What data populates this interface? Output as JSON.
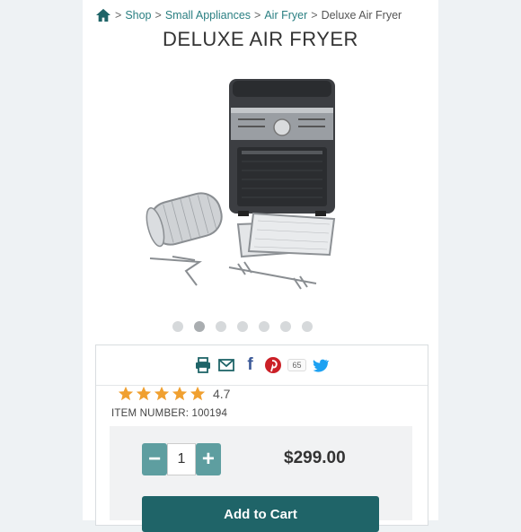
{
  "breadcrumb": {
    "home_icon": "home-icon",
    "items": [
      "Shop",
      "Small Appliances",
      "Air Fryer"
    ],
    "separator": ">",
    "current": "Deluxe Air Fryer"
  },
  "product": {
    "title": "DELUXE AIR FRYER",
    "image_alt": "Deluxe Air Fryer with rotisserie basket, cooking trays and forks",
    "carousel": {
      "count": 7,
      "active_index": 1
    }
  },
  "share": {
    "icons": [
      "print-icon",
      "email-icon",
      "facebook-icon",
      "pinterest-icon",
      "twitter-icon"
    ],
    "pin_count": "65"
  },
  "rating": {
    "stars": 5,
    "value": "4.7"
  },
  "item_number": "ITEM NUMBER: 100194",
  "purchase": {
    "minus": "−",
    "plus": "+",
    "quantity": "1",
    "price": "$299.00",
    "add_to_cart": "Add to Cart"
  },
  "colors": {
    "accent": "#2a7f82",
    "button_dark": "#1f6468",
    "stepper": "#5e9ea0",
    "star": "#f0a030"
  }
}
